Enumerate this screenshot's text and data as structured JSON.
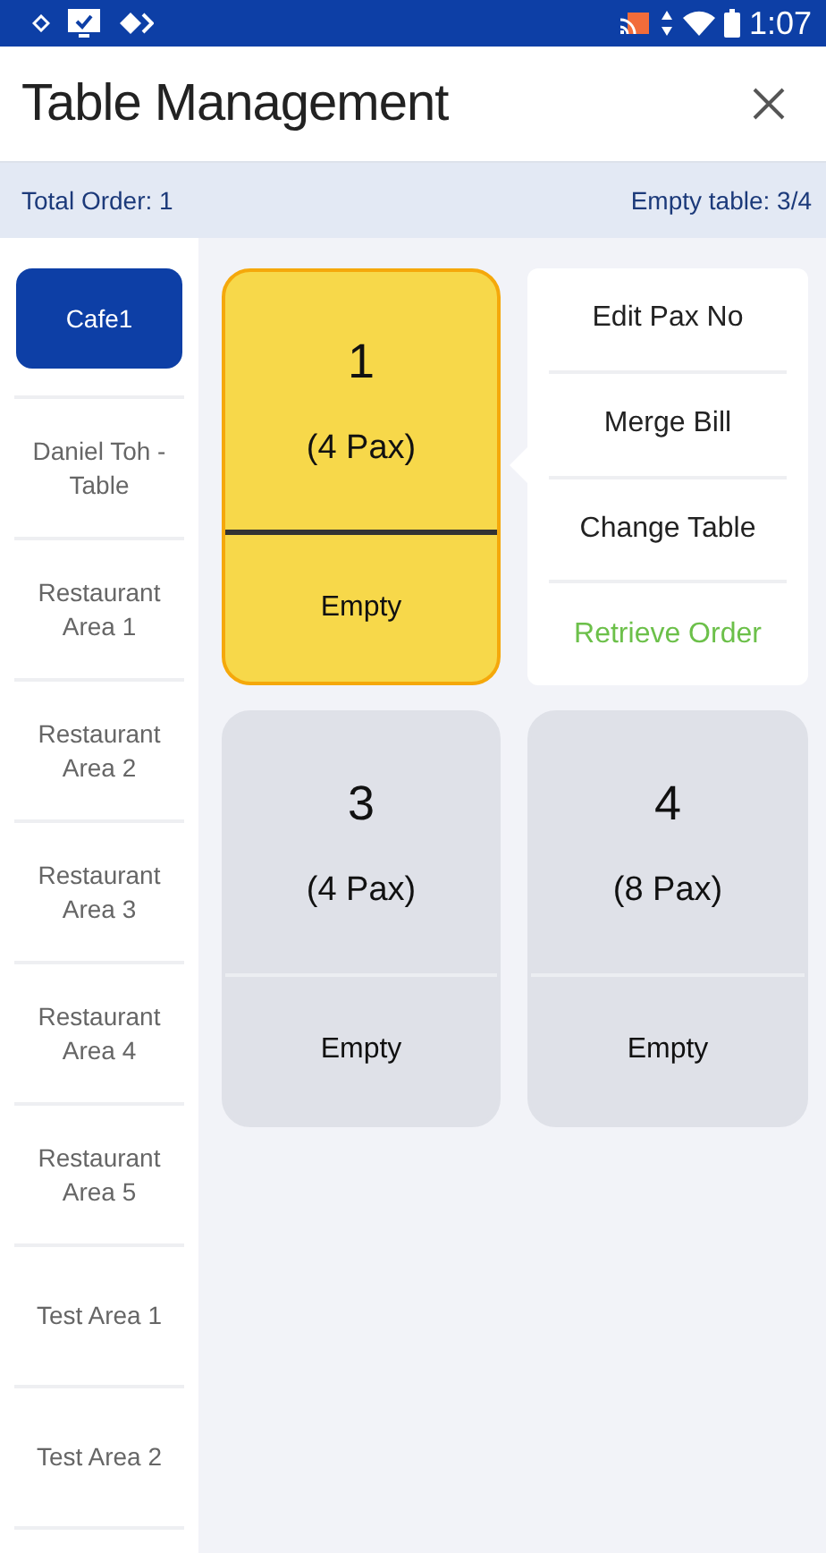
{
  "status_bar": {
    "time": "1:07"
  },
  "header": {
    "title": "Table Management"
  },
  "summary": {
    "total_order": "Total Order: 1",
    "empty_tables": "Empty table: 3/4"
  },
  "areas": [
    {
      "label": "Cafe1",
      "selected": true
    },
    {
      "label": "Daniel Toh - Table",
      "selected": false
    },
    {
      "label": "Restaurant Area 1",
      "selected": false
    },
    {
      "label": "Restaurant Area 2",
      "selected": false
    },
    {
      "label": "Restaurant Area 3",
      "selected": false
    },
    {
      "label": "Restaurant Area 4",
      "selected": false
    },
    {
      "label": "Restaurant Area 5",
      "selected": false
    },
    {
      "label": "Test Area 1",
      "selected": false
    },
    {
      "label": "Test Area 2",
      "selected": false
    }
  ],
  "tables": [
    {
      "number": "1",
      "pax": "(4 Pax)",
      "status": "Empty",
      "selected": true
    },
    {
      "number": "3",
      "pax": "(4 Pax)",
      "status": "Empty",
      "selected": false
    },
    {
      "number": "4",
      "pax": "(8 Pax)",
      "status": "Empty",
      "selected": false
    }
  ],
  "table_menu": {
    "items": [
      {
        "label": "Edit Pax No",
        "color": "#222222"
      },
      {
        "label": "Merge Bill",
        "color": "#222222"
      },
      {
        "label": "Change Table",
        "color": "#222222"
      },
      {
        "label": "Retrieve Order",
        "color": "#6cc04a"
      }
    ]
  }
}
